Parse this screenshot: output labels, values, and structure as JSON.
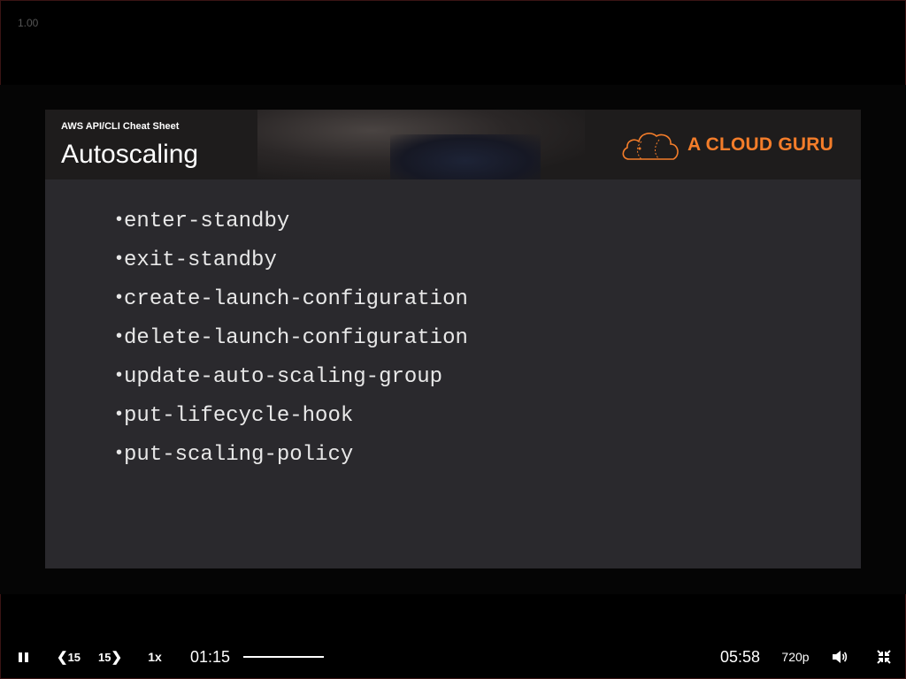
{
  "player": {
    "zoom": "1.00",
    "current_time": "01:15",
    "duration": "05:58",
    "skip_back_label": "15",
    "skip_forward_label": "15",
    "playback_rate": "1x",
    "quality": "720p",
    "progress_fraction": 0.21
  },
  "slide": {
    "kicker": "AWS API/CLI Cheat Sheet",
    "title": "Autoscaling",
    "brand": "A CLOUD GURU",
    "brand_color": "#f47d2a",
    "bullets": [
      "enter-standby",
      "exit-standby",
      "create-launch-configuration",
      "delete-launch-configuration",
      "update-auto-scaling-group",
      "put-lifecycle-hook",
      "put-scaling-policy"
    ]
  },
  "icons": [
    "pause-icon",
    "skip-back-icon",
    "skip-forward-icon",
    "volume-icon",
    "exit-fullscreen-icon",
    "cloud-logo-icon"
  ]
}
